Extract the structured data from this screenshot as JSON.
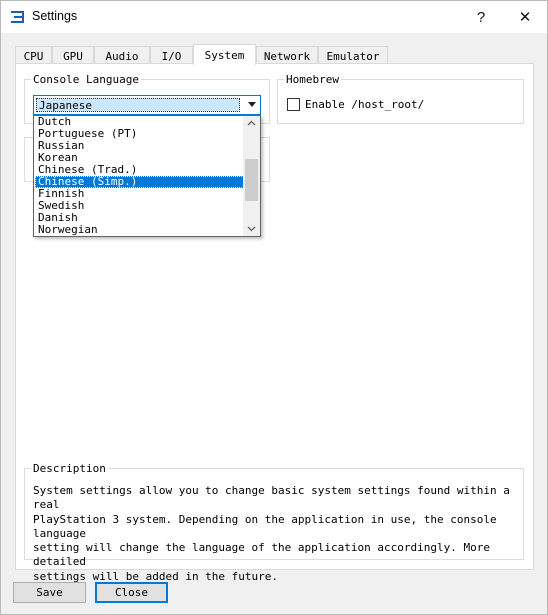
{
  "window": {
    "title": "Settings",
    "help_glyph": "?",
    "close_glyph": "✕"
  },
  "tabs": [
    {
      "label": "CPU"
    },
    {
      "label": "GPU"
    },
    {
      "label": "Audio"
    },
    {
      "label": "I/O"
    },
    {
      "label": "System",
      "active": true
    },
    {
      "label": "Network"
    },
    {
      "label": "Emulator"
    }
  ],
  "console_language": {
    "title": "Console Language",
    "selected_value": "Japanese",
    "options": [
      "Dutch",
      "Portuguese (PT)",
      "Russian",
      "Korean",
      "Chinese (Trad.)",
      "Chinese (Simp.)",
      "Finnish",
      "Swedish",
      "Danish",
      "Norwegian"
    ],
    "highlighted_option": "Chinese (Simp.)"
  },
  "homebrew": {
    "title": "Homebrew",
    "enable_host_root_label": "Enable /host_root/",
    "enable_host_root_checked": false
  },
  "description": {
    "title": "Description",
    "text": "System settings allow you to change basic system settings found within a real\nPlayStation 3 system. Depending on the application in use, the console language\nsetting will change the language of the application accordingly. More detailed\nsettings will be added in the future."
  },
  "buttons": {
    "save_label": "Save",
    "close_label": "Close"
  },
  "colors": {
    "accent": "#0078d7",
    "selection_bg": "#cce8ff"
  }
}
